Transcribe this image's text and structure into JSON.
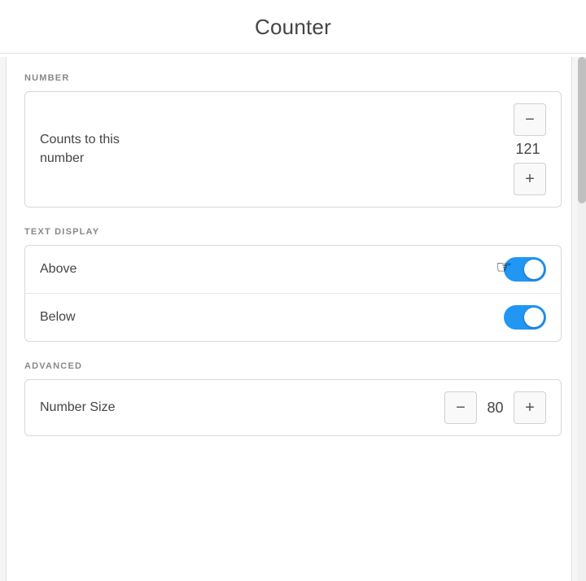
{
  "header": {
    "title": "Counter"
  },
  "sections": {
    "number": {
      "label": "NUMBER",
      "row": {
        "description_line1": "Counts to this",
        "description_line2": "number",
        "value": "121",
        "minus_label": "−",
        "plus_label": "+"
      }
    },
    "text_display": {
      "label": "TEXT DISPLAY",
      "rows": [
        {
          "label": "Above",
          "toggle": true
        },
        {
          "label": "Below",
          "toggle": true
        }
      ]
    },
    "advanced": {
      "label": "ADVANCED",
      "row": {
        "label": "Number Size",
        "value": "80",
        "minus_label": "−",
        "plus_label": "+"
      }
    }
  },
  "icons": {
    "cursor": "☜"
  }
}
